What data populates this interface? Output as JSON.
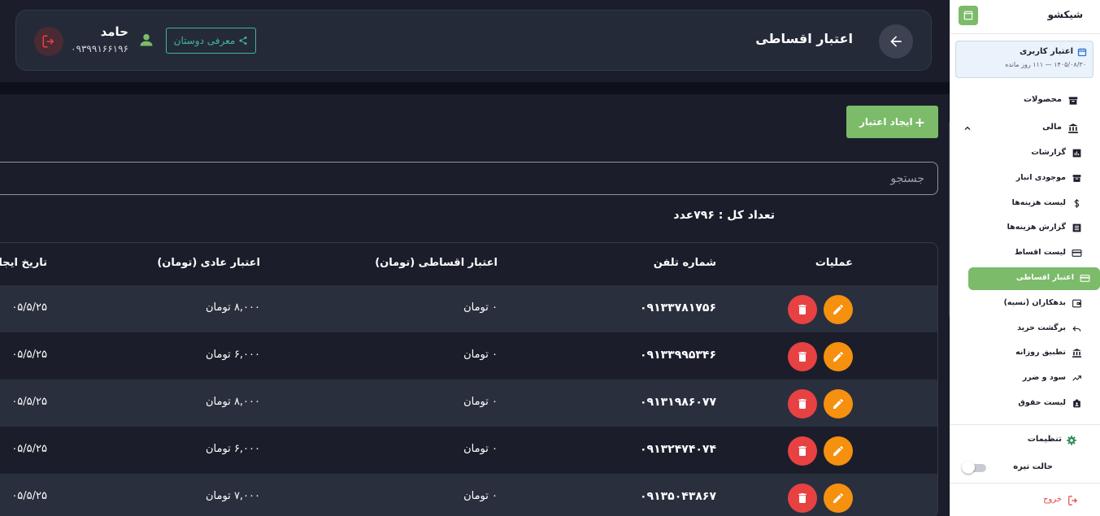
{
  "header": {
    "title": "اعتبار اقساطی",
    "user_name": "حامد",
    "user_phone": "۰۹۳۹۹۱۶۶۱۹۶",
    "invite_label": "معرفی دوستان"
  },
  "toolbar": {
    "create_label": "ایجاد اعتبار",
    "search_placeholder": "جستجو",
    "count_text": "تعداد کل : ۷۹۶عدد"
  },
  "table": {
    "columns": {
      "actions": "عملیات",
      "phone": "شماره تلفن",
      "installment": "اعتبار اقساطی (تومان)",
      "regular": "اعتبار عادی (تومان)",
      "date": "تاریخ ایجا"
    },
    "rows": [
      {
        "phone": "۰۹۱۳۳۷۸۱۷۵۶",
        "installment": "۰ تومان",
        "regular": "۸,۰۰۰ تومان",
        "date": "۰۵/۵/۲۵"
      },
      {
        "phone": "۰۹۱۳۳۹۹۵۳۴۶",
        "installment": "۰ تومان",
        "regular": "۶,۰۰۰ تومان",
        "date": "۰۵/۵/۲۵"
      },
      {
        "phone": "۰۹۱۳۱۹۸۶۰۷۷",
        "installment": "۰ تومان",
        "regular": "۸,۰۰۰ تومان",
        "date": "۰۵/۵/۲۵"
      },
      {
        "phone": "۰۹۱۳۲۴۷۴۰۷۴",
        "installment": "۰ تومان",
        "regular": "۶,۰۰۰ تومان",
        "date": "۰۵/۵/۲۵"
      },
      {
        "phone": "۰۹۱۳۵۰۴۳۸۶۷",
        "installment": "۰ تومان",
        "regular": "۷,۰۰۰ تومان",
        "date": "۰۵/۵/۲۵"
      }
    ]
  },
  "sidebar": {
    "brand": "شیکشو",
    "credit_title": "اعتبار کاربری",
    "credit_sub": "۱۴۰۵/۰۸/۳۰ — ۱۱۱ روز مانده",
    "products": "محصولات",
    "finance": "مالی",
    "items": [
      {
        "label": "گزارشات",
        "icon": "chart-icon"
      },
      {
        "label": "موجودی انبار",
        "icon": "archive-icon"
      },
      {
        "label": "لیست هزینه‌ها",
        "icon": "dollar-icon"
      },
      {
        "label": "گزارش هزینه‌ها",
        "icon": "list-icon"
      },
      {
        "label": "لیست اقساط",
        "icon": "card-icon"
      },
      {
        "label": "اعتبار اقساطی",
        "icon": "card-icon"
      },
      {
        "label": "بدهکاران (نسیه)",
        "icon": "wallet-icon"
      },
      {
        "label": "برگشت خرید",
        "icon": "undo-icon"
      },
      {
        "label": "تطبیق روزانه",
        "icon": "bank-icon"
      },
      {
        "label": "سود و ضرر",
        "icon": "trend-icon"
      },
      {
        "label": "لیست حقوق",
        "icon": "badge-icon"
      }
    ],
    "settings": "تنظیمات",
    "dark_mode": "حالت تیره",
    "logout": "خروج"
  },
  "colors": {
    "accent_green": "#7cbb6a",
    "delete_red": "#e84142",
    "edit_orange": "#f6900f",
    "teal": "#3fb6a0"
  }
}
